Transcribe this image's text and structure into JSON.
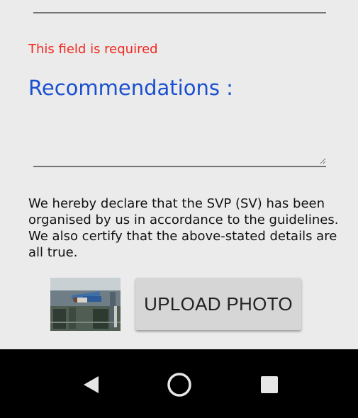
{
  "form": {
    "error_text": "This field is required",
    "recommendations_label": "Recommendations :",
    "recommendations_value": "",
    "declaration": "We hereby declare that the SVP (SV) has been organised by us in accordance to the guidelines. We also certify that the above-stated details are all true.",
    "upload_button_label": "UPLOAD PHOTO"
  },
  "colors": {
    "error": "#f0281e",
    "label_accent": "#1a4fd0",
    "background": "#ebebeb",
    "navbar": "#000000"
  },
  "navbar": {
    "icons": [
      "back-triangle-icon",
      "home-circle-icon",
      "recents-square-icon"
    ]
  }
}
